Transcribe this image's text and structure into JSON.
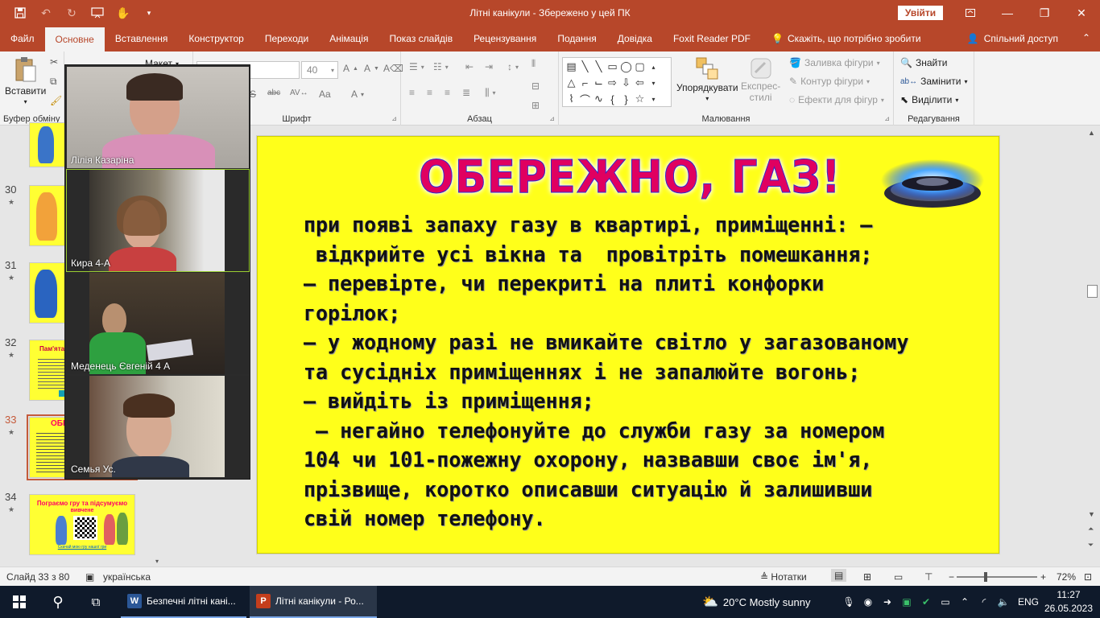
{
  "window": {
    "title": "Літні канікули  -  Збережено у цей ПК",
    "signin_label": "Увійти"
  },
  "tabs": [
    {
      "label": "Файл"
    },
    {
      "label": "Основне"
    },
    {
      "label": "Вставлення"
    },
    {
      "label": "Конструктор"
    },
    {
      "label": "Переходи"
    },
    {
      "label": "Анімація"
    },
    {
      "label": "Показ слайдів"
    },
    {
      "label": "Рецензування"
    },
    {
      "label": "Подання"
    },
    {
      "label": "Довідка"
    },
    {
      "label": "Foxit Reader PDF"
    }
  ],
  "tell_me": "Скажіть, що потрібно зробити",
  "share_label": "Спільний доступ",
  "ribbon": {
    "paste_label": "Вставити",
    "clipboard_label": "Буфер обміну",
    "layout_label": "Макет",
    "font_size": "40",
    "font_label": "Шрифт",
    "paragraph_label": "Абзац",
    "arrange_label": "Упорядкувати",
    "quick_styles_line1": "Експрес-",
    "quick_styles_line2": "стилі",
    "shape_fill": "Заливка фігури",
    "shape_outline": "Контур фігури",
    "shape_effects": "Ефекти для фігур",
    "drawing_label": "Малювання",
    "find_label": "Знайти",
    "replace_label": "Замінити",
    "select_label": "Виділити",
    "editing_label": "Редагування"
  },
  "thumbnails": [
    {
      "num": "30"
    },
    {
      "num": "31"
    },
    {
      "num": "32",
      "title": "Пам'ятайте"
    },
    {
      "num": "33",
      "title": "ОБЕ"
    },
    {
      "num": "34",
      "title": "Пограємо гру та підсумуємо",
      "subtitle": "вивчене",
      "link": "Скачай мою гру нашої гри"
    }
  ],
  "participants": [
    {
      "name": "Лілія Казаріна"
    },
    {
      "name": "Кира 4-А"
    },
    {
      "name": "Меденець Євгеній 4 А"
    },
    {
      "name": "Семья Ус."
    }
  ],
  "slide": {
    "title": "ОБЕРЕЖНО, ГАЗ!",
    "lines": [
      "при появі запаху газу в квартирі, приміщенні: –",
      " відкрийте усі вікна та  провітріть помешкання;",
      "– перевірте, чи перекриті на плиті конфорки",
      "горілок;",
      "– у жодному разі не вмикайте світло у загазованому",
      "та сусідніх приміщеннях і не запалюйте вогонь;",
      "– вийдіть із приміщення;",
      " – негайно телефонуйте до служби газу за номером",
      "104 чи 101-пожежну охорону, назвавши своє ім'я,",
      "прізвище, коротко описавши ситуацію й залишивши",
      "свій номер телефону."
    ]
  },
  "status": {
    "slide_counter": "Слайд 33 з 80",
    "language": "українська",
    "notes_label": "Нотатки",
    "zoom": "72%",
    "zoom_value": 0.72
  },
  "taskbar": {
    "word_label": "Безпечні літні кані...",
    "ppt_label": "Літні канікули - Ро...",
    "weather": "20°C  Mostly sunny",
    "lang": "ENG",
    "time": "11:27",
    "date": "26.05.2023"
  },
  "colors": {
    "accent": "#b7472a",
    "slide_bg": "#ffff1a",
    "title_color": "#e00060"
  }
}
